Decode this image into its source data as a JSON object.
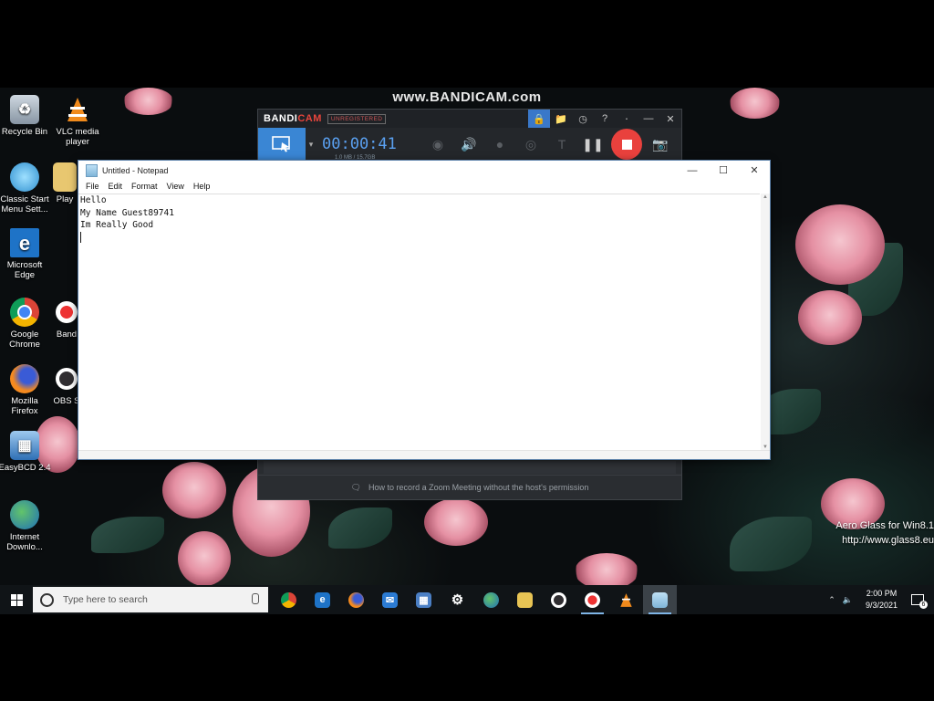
{
  "watermark": "www.BANDICAM.com",
  "desktop_icons": [
    {
      "label1": "Recycle Bin",
      "label2": "",
      "icon": "recycle-bin-icon"
    },
    {
      "label1": "VLC media",
      "label2": "player",
      "icon": "vlc-icon"
    },
    {
      "label1": "Classic Start",
      "label2": "Menu Sett...",
      "icon": "classic-start-icon"
    },
    {
      "label1": "Play",
      "label2": "",
      "icon": "folder-icon"
    },
    {
      "label1": "Microsoft",
      "label2": "Edge",
      "icon": "edge-icon"
    },
    {
      "label1": "Google",
      "label2": "Chrome",
      "icon": "chrome-icon"
    },
    {
      "label1": "Band",
      "label2": "",
      "icon": "bandicam-icon"
    },
    {
      "label1": "Mozilla",
      "label2": "Firefox",
      "icon": "firefox-icon"
    },
    {
      "label1": "OBS S",
      "label2": "",
      "icon": "obs-icon"
    },
    {
      "label1": "EasyBCD 2.4",
      "label2": "",
      "icon": "easybcd-icon"
    },
    {
      "label1": "Internet",
      "label2": "Downlo...",
      "icon": "idm-icon"
    }
  ],
  "bandicam": {
    "logo_main": "BANDI",
    "logo_accent": "CAM",
    "unregistered": "UNREGISTERED",
    "timer": "00:00:41",
    "size": "1.0 MB / 15.7GB",
    "status": "How to record a Zoom Meeting without the host's permission"
  },
  "notepad": {
    "title": "Untitled - Notepad",
    "menu": [
      "File",
      "Edit",
      "Format",
      "View",
      "Help"
    ],
    "lines": [
      "Hello",
      "My Name Guest89741",
      "Im Really Good"
    ]
  },
  "aero": {
    "line1": "Aero Glass for Win8.1",
    "line2": "http://www.glass8.eu"
  },
  "taskbar": {
    "search_placeholder": "Type here to search",
    "time": "2:00 PM",
    "date": "9/3/2021",
    "notifications": "6"
  },
  "colors": {
    "accent": "#3a86d4",
    "record": "#e9413d",
    "bandicam_bg": "#2a2d31"
  }
}
